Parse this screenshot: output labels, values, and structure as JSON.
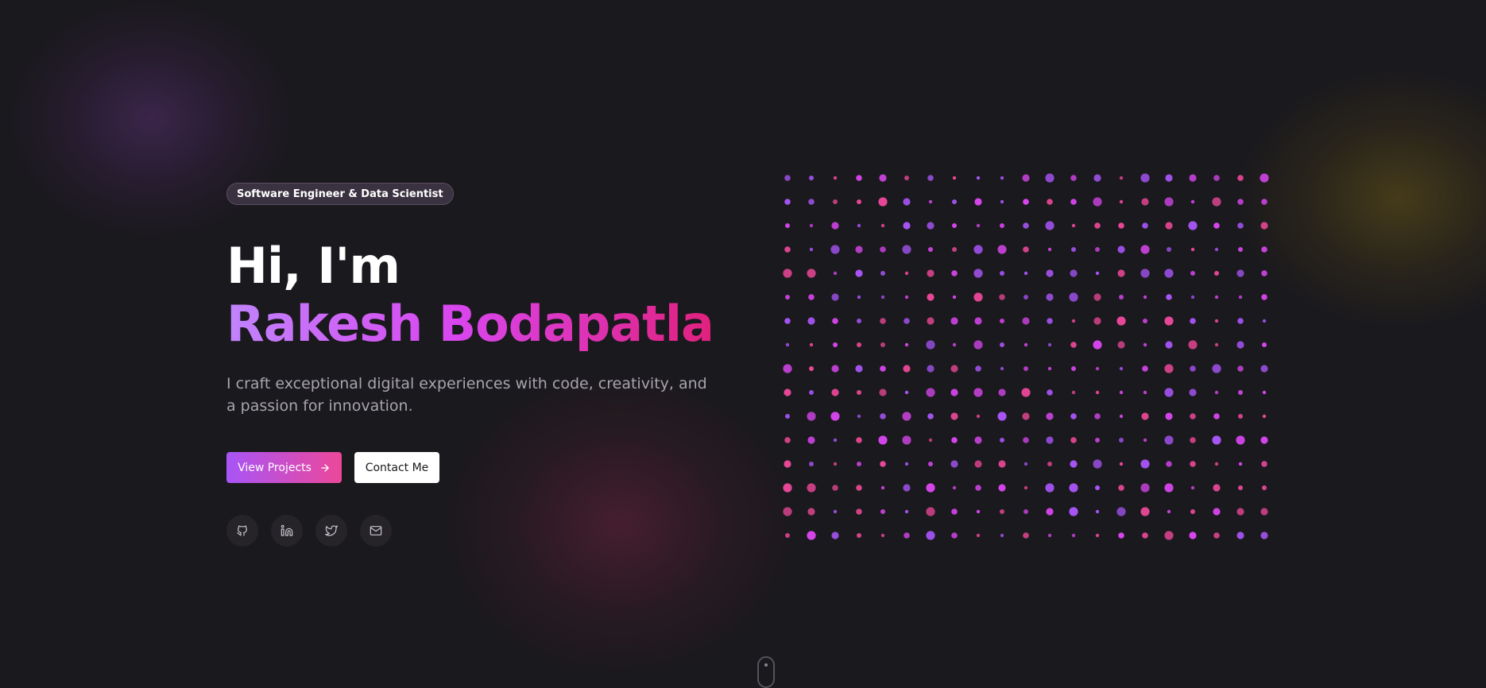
{
  "hero": {
    "badge": "Software Engineer & Data Scientist",
    "greeting": "Hi, I'm",
    "name": "Rakesh Bodapatla",
    "tagline": "I craft exceptional digital experiences with code, creativity, and a passion for innovation.",
    "primary_button": "View Projects",
    "secondary_button": "Contact Me"
  },
  "socials": [
    {
      "name": "github",
      "icon": "github-icon"
    },
    {
      "name": "linkedin",
      "icon": "linkedin-icon"
    },
    {
      "name": "twitter",
      "icon": "twitter-icon"
    },
    {
      "name": "email",
      "icon": "mail-icon"
    }
  ],
  "colors": {
    "background": "#1a191d",
    "accent_purple": "#a855f7",
    "accent_pink": "#ec4899",
    "gradient_start": "#c084fc",
    "gradient_end": "#e11d74",
    "dot_colors": [
      "#d946ef",
      "#a855f7",
      "#ec4899"
    ]
  },
  "dot_pattern": {
    "rows": 16,
    "columns": 21
  }
}
